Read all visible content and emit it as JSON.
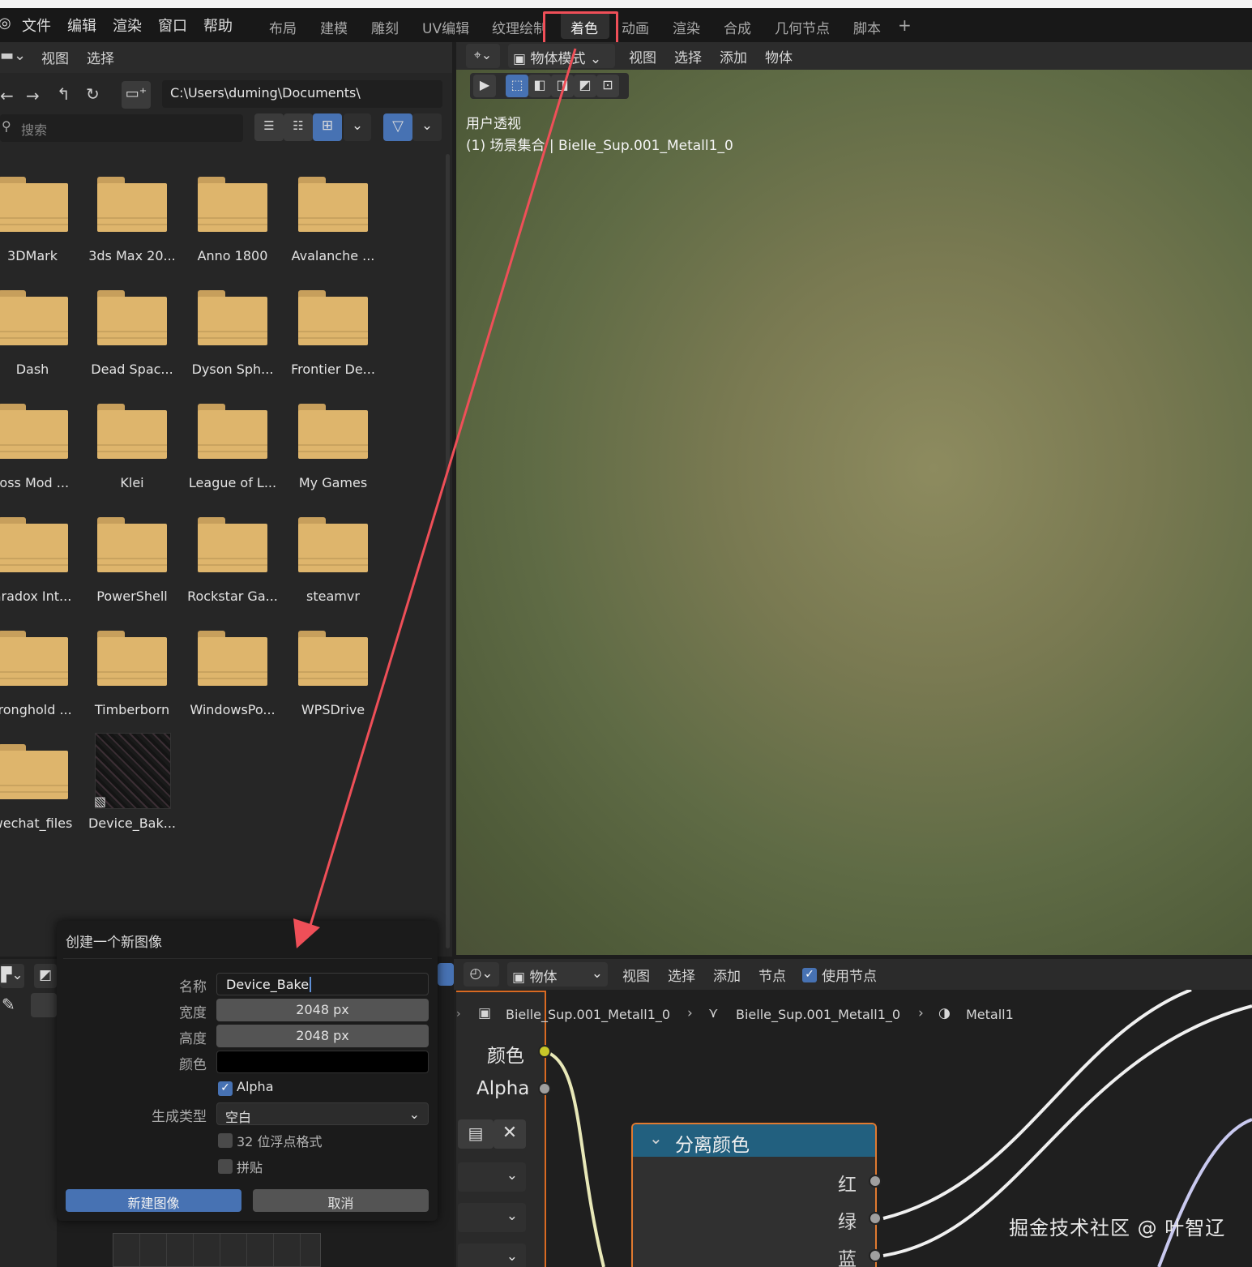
{
  "menu": [
    "文件",
    "编辑",
    "渲染",
    "窗口",
    "帮助"
  ],
  "workspaces": [
    "布局",
    "建模",
    "雕刻",
    "UV编辑",
    "纹理绘制",
    "着色",
    "动画",
    "渲染",
    "合成",
    "几何节点",
    "脚本"
  ],
  "workspace_add": "+",
  "file_browser": {
    "header_menu": [
      "视图",
      "选择"
    ],
    "path": "C:\\Users\\duming\\Documents\\",
    "search_placeholder": "搜索",
    "items": [
      "3DMark",
      "3ds Max 20...",
      "Anno 1800",
      "Avalanche ...",
      "Dash",
      "Dead Spac...",
      "Dyson Sph...",
      "Frontier De...",
      "loss Mod ...",
      "Klei",
      "League of L...",
      "My Games",
      "aradox Int...",
      "PowerShell",
      "Rockstar Ga...",
      "steamvr",
      "tronghold ...",
      "Timberborn",
      "WindowsPo...",
      "WPSDrive",
      "wechat_files",
      "Device_Bak..."
    ]
  },
  "viewport": {
    "mode": "物体模式",
    "menu": [
      "视图",
      "选择",
      "添加",
      "物体"
    ],
    "overlay_title": "用户透视",
    "overlay_info": "(1) 场景集合 | Bielle_Sup.001_Metall1_0"
  },
  "node_editor": {
    "object_select": "物体",
    "menu": [
      "视图",
      "选择",
      "添加",
      "节点"
    ],
    "use_nodes_label": "使用节点",
    "breadcrumb": [
      "Bielle_Sup.001_Metall1_0",
      "Bielle_Sup.001_Metall1_0",
      "Metall1"
    ],
    "group_outputs": [
      "颜色",
      "Alpha"
    ],
    "split_node": {
      "title": "分离颜色",
      "outputs": [
        "红",
        "绿",
        "蓝"
      ]
    }
  },
  "dialog": {
    "title": "创建一个新图像",
    "name_label": "名称",
    "name_value": "Device_Bake",
    "width_label": "宽度",
    "width_value": "2048 px",
    "height_label": "高度",
    "height_value": "2048 px",
    "color_label": "颜色",
    "alpha_label": "Alpha",
    "alpha_checked": true,
    "gen_type_label": "生成类型",
    "gen_type_value": "空白",
    "float_label": "32 位浮点格式",
    "tile_label": "拼贴",
    "ok_label": "新建图像",
    "cancel_label": "取消"
  },
  "colors": {
    "highlight": "#ef4f58",
    "accent": "#4772b3",
    "folder": "#deb56c",
    "node_header": "#22607f",
    "node_border": "#e07a30"
  },
  "watermark": "掘金技术社区 @ 叶智辽"
}
